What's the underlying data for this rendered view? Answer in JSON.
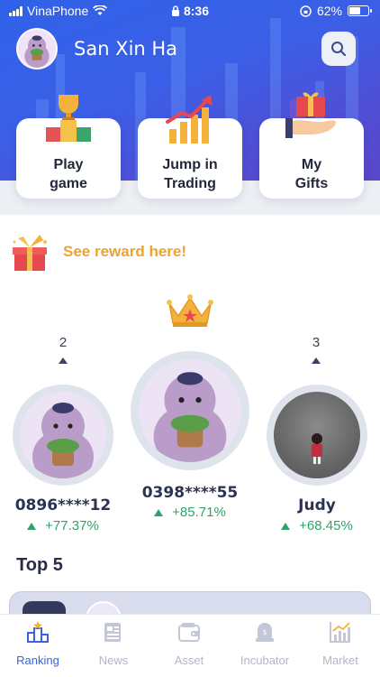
{
  "status_bar": {
    "carrier": "VinaPhone",
    "time": "8:36",
    "battery_percent": "62%",
    "battery_level": 0.62
  },
  "header": {
    "username": "San Xin Ha",
    "search_icon": "search-icon"
  },
  "quick_actions": [
    {
      "line1": "Play",
      "line2": "game",
      "icon": "trophy-podium-icon"
    },
    {
      "line1": "Jump in",
      "line2": "Trading",
      "icon": "rising-chart-icon"
    },
    {
      "line1": "My",
      "line2": "Gifts",
      "icon": "gift-hand-icon"
    }
  ],
  "reward": {
    "text": "See reward here!",
    "icon": "gift-box-icon"
  },
  "podium": {
    "first": {
      "name": "0398****55",
      "change": "+85.71%"
    },
    "second": {
      "rank": "2",
      "name": "0896****12",
      "change": "+77.37%"
    },
    "third": {
      "rank": "3",
      "name": "Judy",
      "change": "+68.45%"
    }
  },
  "section": {
    "title": "Top 5"
  },
  "tabs": [
    {
      "label": "Ranking",
      "icon": "ranking-icon",
      "active": true
    },
    {
      "label": "News",
      "icon": "news-icon",
      "active": false
    },
    {
      "label": "Asset",
      "icon": "wallet-icon",
      "active": false
    },
    {
      "label": "Incubator",
      "icon": "incubator-icon",
      "active": false
    },
    {
      "label": "Market",
      "icon": "market-chart-icon",
      "active": false
    }
  ],
  "colors": {
    "header_blue": "#2f62e8",
    "accent_orange": "#f0a12e",
    "positive_green": "#2ea36b",
    "active_tab": "#3a63e0"
  }
}
